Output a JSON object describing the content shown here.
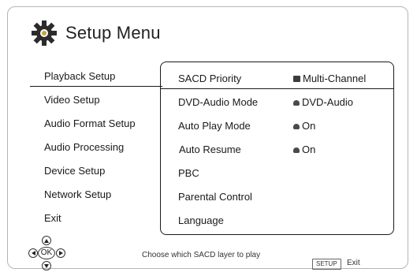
{
  "header": {
    "title": "Setup Menu",
    "icon": "gear-icon"
  },
  "menu": {
    "items": [
      {
        "label": "Playback Setup",
        "active": true
      },
      {
        "label": "Video Setup"
      },
      {
        "label": "Audio Format Setup"
      },
      {
        "label": "Audio Processing"
      },
      {
        "label": "Device Setup"
      },
      {
        "label": "Network Setup"
      },
      {
        "label": "Exit"
      }
    ]
  },
  "panel": {
    "rows": [
      {
        "label": "SACD Priority",
        "value": "Multi-Channel",
        "icon": "square",
        "active": true
      },
      {
        "label": "DVD-Audio Mode",
        "value": "DVD-Audio",
        "icon": "disc"
      },
      {
        "label": "Auto Play Mode",
        "value": "On",
        "icon": "disc"
      },
      {
        "label": "Auto Resume",
        "value": "On",
        "icon": "disc"
      },
      {
        "label": "PBC",
        "value": ""
      },
      {
        "label": "Parental Control",
        "value": ""
      },
      {
        "label": "Language",
        "value": ""
      }
    ]
  },
  "footer": {
    "nav_ok": "OK",
    "hint": "Choose which SACD layer to play",
    "setup_key": "SETUP",
    "exit_label": "Exit"
  }
}
